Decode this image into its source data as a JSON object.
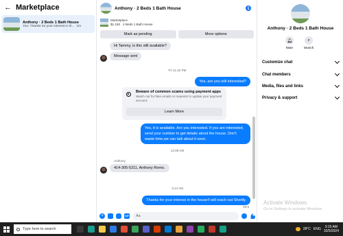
{
  "left": {
    "title": "Marketplace",
    "conversation": {
      "name": "Anthony · 2 Beds 1 Bath House",
      "preview": "You: Thanks for your interest in th...",
      "time": "1m"
    }
  },
  "chat": {
    "header_name": "Anthony · 2 Beds 1 Bath House",
    "marketplace_label": "Marketplace",
    "listing": "$1,150 · 2 Beds 1 Bath House",
    "mark_pending": "Mark as pending",
    "more_options": "More options",
    "messages": {
      "in1": "Hi Tammy, is this still available?",
      "in2": "Message sent",
      "ts1": "Fri 11:42 PM",
      "out1": "Yes, are you still interested?",
      "warn_title": "Beware of common scams using payment apps",
      "warn_body": "Watch out for fake emails or requests to update your payment account.",
      "learn_more": "Learn More",
      "out2": "Yes, it is available. Are you interested. If you are interested, send your number to get details about the house. Don't waste time,we can talk about it soon.",
      "ts2": "12:08 AM",
      "sender": "Anthony",
      "in3": "414-305-5211, Anthony Romo.",
      "ts3": "3:14 AM",
      "out3": "Thanks for your interest in the house!I will reach out Shortly.",
      "sent": "Sent"
    },
    "composer_placeholder": "Aa"
  },
  "details": {
    "name": "Anthony · 2 Beds 1 Bath House",
    "mute": "Mute",
    "search": "Search",
    "rows": [
      "Customize chat",
      "Chat members",
      "Media, files and links",
      "Privacy & support"
    ],
    "watermark_title": "Activate Windows",
    "watermark_sub": "Go to Settings to activate Windows."
  },
  "taskbar": {
    "search_placeholder": "Type here to search",
    "temperature": "28°C",
    "lang": "ENG",
    "time": "3:15 AM",
    "date": "10/5/2024"
  },
  "colors": {
    "accent": "#0a7cff",
    "bubble_in": "#e4e6eb",
    "selected": "#e7f0fb",
    "taskbar": "#202020"
  }
}
